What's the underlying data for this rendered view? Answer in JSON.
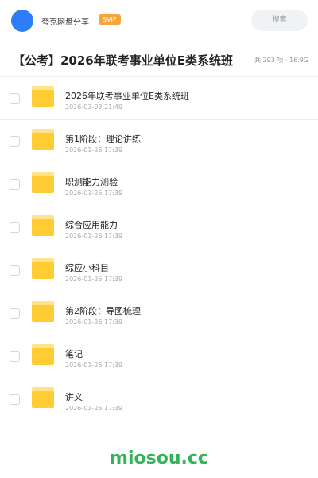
{
  "header": {
    "brand": "夸克网盘分享",
    "badge": "SVIP",
    "search_placeholder": "搜索"
  },
  "share": {
    "title": "【公考】2026年联考事业单位E类系统班",
    "meta": "共 293 项 · 16.9G"
  },
  "files": [
    {
      "name": "2026年联考事业单位E类系统班",
      "date": "2026-03-03 21:49"
    },
    {
      "name": "第1阶段：理论讲练",
      "date": "2026-01-26 17:39"
    },
    {
      "name": "职测能力测验",
      "date": "2026-01-26 17:39"
    },
    {
      "name": "综合应用能力",
      "date": "2026-01-26 17:39"
    },
    {
      "name": "综应小科目",
      "date": "2026-01-26 17:39"
    },
    {
      "name": "第2阶段：导图梳理",
      "date": "2026-01-26 17:39"
    },
    {
      "name": "笔记",
      "date": "2026-01-26 17:39"
    },
    {
      "name": "讲义",
      "date": "2026-01-26 17:39"
    }
  ],
  "footer": {
    "watermark": "miosou.cc"
  },
  "colors": {
    "accent_blue": "#2d7df6",
    "svip_orange": "#f7a43a",
    "folder_yellow": "#ffcc33",
    "watermark_green": "#34b35a"
  }
}
